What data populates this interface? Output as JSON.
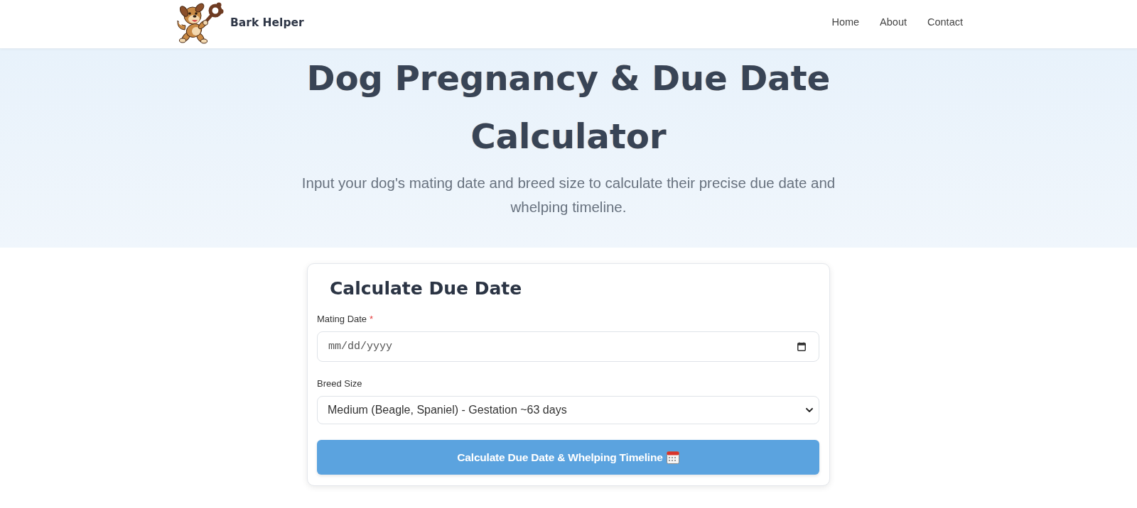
{
  "header": {
    "brand": "Bark Helper",
    "nav": [
      {
        "label": "Home"
      },
      {
        "label": "About"
      },
      {
        "label": "Contact"
      }
    ]
  },
  "hero": {
    "title": "Dog Pregnancy & Due Date Calculator",
    "subtitle": "Input your dog's mating date and breed size to calculate their precise due date and whelping timeline."
  },
  "form": {
    "title": "Calculate Due Date",
    "fields": [
      {
        "kind": "date",
        "label": "Mating Date",
        "required_mark": "*",
        "placeholder": "mm/dd/yyyy"
      },
      {
        "kind": "select",
        "label": "Breed Size",
        "value": "Medium (Beagle, Spaniel) - Gestation ~63 days"
      }
    ],
    "submit": "Calculate Due Date & Whelping Timeline"
  }
}
